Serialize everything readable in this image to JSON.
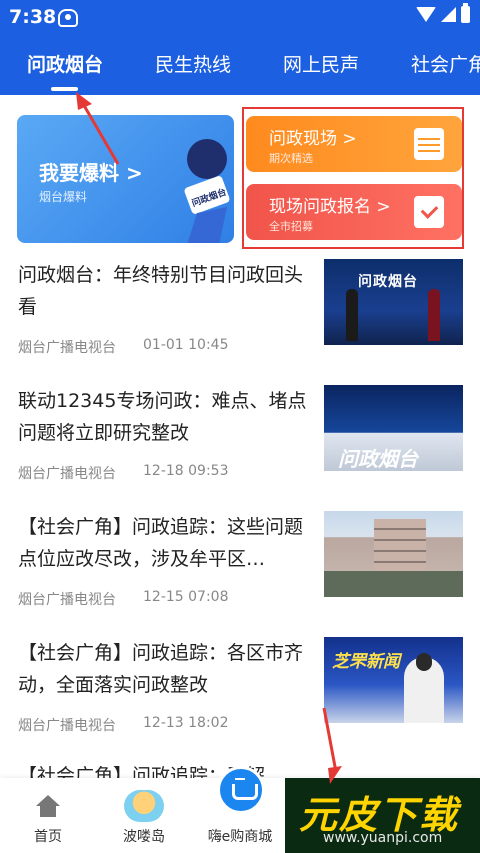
{
  "status_bar": {
    "time": "7:38"
  },
  "tabs": [
    {
      "label": "问政烟台",
      "active": true
    },
    {
      "label": "民生热线",
      "active": false
    },
    {
      "label": "网上民声",
      "active": false
    },
    {
      "label": "社会广角",
      "active": false
    }
  ],
  "banners": {
    "main": {
      "title": "我要爆料 >",
      "subtitle": "烟台爆料",
      "mic_label": "问政烟台"
    },
    "live": {
      "title": "问政现场 >",
      "subtitle": "期次精选",
      "icon": "calendar-icon"
    },
    "signup": {
      "title": "现场问政报名 >",
      "subtitle": "全市招募",
      "icon": "checklist-icon"
    }
  },
  "news": [
    {
      "title": "问政烟台：年终特别节目问政回头看",
      "source": "烟台广播电视台",
      "time": "01-01 10:45",
      "thumb_text": "问政烟台"
    },
    {
      "title": "联动12345专场问政：难点、堵点问题将立即研究整改",
      "source": "烟台广播电视台",
      "time": "12-18 09:53",
      "thumb_text": "问政烟台"
    },
    {
      "title": "【社会广角】问政追踪：这些问题点位应改尽改，涉及牟平区…",
      "source": "烟台广播电视台",
      "time": "12-15 07:08",
      "thumb_text": ""
    },
    {
      "title": "【社会广角】问政追踪：各区市齐动，全面落实问政整改",
      "source": "烟台广播电视台",
      "time": "12-13 18:02",
      "thumb_text": "芝罘新闻"
    }
  ],
  "partial_news_title": "【社会广角】问政追踪：已解",
  "bottom_nav": [
    {
      "label": "首页",
      "icon": "home-icon"
    },
    {
      "label": "波喽岛",
      "icon": "island-icon"
    },
    {
      "label": "嗨e购商城",
      "icon": "shopping-basket-icon"
    }
  ],
  "watermark": {
    "big": "元皮下载",
    "small": "www.yuanpi.com"
  },
  "colors": {
    "header_blue": "#1c5fe0",
    "orange": "#ff8a1e",
    "red": "#f1544a",
    "annotation_red": "#e53935"
  }
}
